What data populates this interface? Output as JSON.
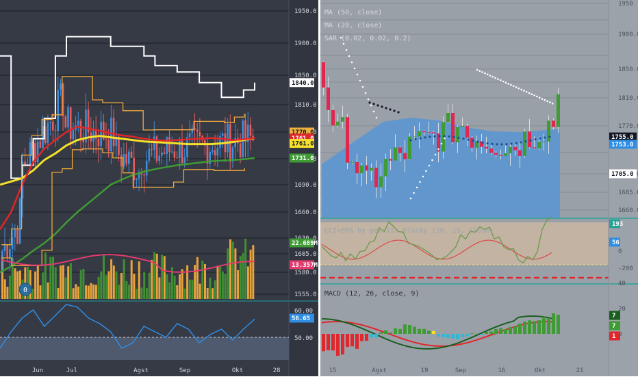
{
  "left": {
    "price_ticks": [
      "1950.0",
      "1900.0",
      "1850.0",
      "1810.0",
      "1770.0",
      "1730.0",
      "1690.0",
      "1660.0",
      "1630.0",
      "1605.0",
      "1580.0",
      "1555.0"
    ],
    "price_tick_values": [
      1950,
      1900,
      1850,
      1810,
      1770,
      1730,
      1690,
      1660,
      1630,
      1605,
      1580,
      1555
    ],
    "rsi_ticks": [
      "60.00",
      "50.00"
    ],
    "time_ticks": [
      "Jun",
      "Jul",
      "Agst",
      "Sep",
      "Okt",
      "28"
    ],
    "badges": [
      {
        "text": "1840.0",
        "bg": "#ffffff",
        "fg": "#131722",
        "value": 1840
      },
      {
        "text": "1770.0",
        "bg": "#f0b03c",
        "fg": "#131722",
        "value": 1770
      },
      {
        "text": "1761.0",
        "bg": "#e0272b",
        "fg": "#ffffff",
        "value": 1761
      },
      {
        "text": "1761.0",
        "bg": "#f5e12a",
        "fg": "#131722",
        "value": 1753
      },
      {
        "text": "1731.0",
        "bg": "#3f9b34",
        "fg": "#ffffff",
        "value": 1731
      },
      {
        "text": "22.689M",
        "bg": "#3f9b34",
        "fg": "#ffffff",
        "pane": "volume"
      },
      {
        "text": "13.357M",
        "bg": "#e23b6e",
        "fg": "#ffffff",
        "pane": "volume"
      },
      {
        "text": "56.65",
        "bg": "#2f8de4",
        "fg": "#ffffff",
        "pane": "rsi"
      }
    ],
    "events_icon": "0",
    "colors": {
      "up": "#3d8edb",
      "down": "#e55e5e",
      "highest": "#ffffff",
      "donchian": "#f0a93c",
      "ma_red": "#e0272b",
      "ma_yellow": "#f5e12a",
      "ma_green": "#3f9b34",
      "vol_up": "#3f8f34",
      "vol_down": "#e8a43b",
      "vol_ma": "#e23b6e",
      "rsi": "#2f8de4"
    }
  },
  "right": {
    "legends": [
      "MA (50, close)",
      "MA (20, close)",
      "SAR (0.02, 0.02, 0.2)",
      "CCI+EMA by perrito Blacky (20, 13, close)",
      "MACD (12, 26, close, 9)"
    ],
    "price_ticks": [
      "1950",
      "1900.0",
      "1850.0",
      "1810.0",
      "1770.0",
      "1705.0",
      "1685.0",
      "1660.0"
    ],
    "price_tick_values": [
      1950,
      1900,
      1850,
      1810,
      1770,
      1705,
      1685,
      1660
    ],
    "cci_ticks": [
      "0",
      "-200",
      "40"
    ],
    "macd_ticks": [
      "20",
      "0"
    ],
    "time_ticks": [
      "15",
      "Agst",
      "19",
      "Sep",
      "16",
      "Okt",
      "21"
    ],
    "badges": [
      {
        "text": "1755.0",
        "bg": "#131722",
        "fg": "#ffffff",
        "value": 1755
      },
      {
        "text": "1753.0",
        "bg": "#2f8de4",
        "fg": "#ffffff",
        "value": 1745
      },
      {
        "text": "1705.0",
        "bg": "#ffffff",
        "fg": "#131722",
        "value": 1705
      },
      {
        "text": "193",
        "bg": "#2aa198",
        "fg": "#ffffff",
        "pane": "cci"
      },
      {
        "text": "56",
        "bg": "#2f8de4",
        "fg": "#ffffff",
        "pane": "cci"
      },
      {
        "text": "7",
        "bg": "#1a5e20",
        "fg": "#ffffff",
        "pane": "macd"
      },
      {
        "text": "7",
        "bg": "#3f9b34",
        "fg": "#ffffff",
        "pane": "macd"
      },
      {
        "text": "1",
        "bg": "#e0272b",
        "fg": "#ffffff",
        "pane": "macd"
      }
    ],
    "colors": {
      "up": "#3f9b34",
      "down": "#e0274f",
      "area": "#5f97cf",
      "sar": "#ffffff",
      "cci": "#6a9a4a",
      "cci_ema": "#d9534f",
      "macd": "#1a5e20",
      "signal": "#e0272b",
      "hist_pos": "#3f9b34",
      "hist_neg": "#e0272b",
      "hist_neg2": "#2fb9d6",
      "hist_yellow": "#f5e12a"
    }
  },
  "chart_data": [
    {
      "type": "line",
      "title": "",
      "panel": "left",
      "xlabel": "",
      "ylabel": "",
      "x_tick_labels": [
        "Jun",
        "Jul",
        "Agst",
        "Sep",
        "Okt",
        "28"
      ],
      "ylim": [
        1540,
        1960
      ],
      "series": [
        {
          "values": [
            1880,
            1700,
            1720,
            1760,
            1790,
            1880,
            1910,
            1910,
            1910,
            1910,
            1895,
            1895,
            1895,
            1880,
            1865,
            1865,
            1855,
            1855,
            1840,
            1840,
            1820,
            1820,
            1830,
            1840
          ]
        },
        {
          "values": [
            1690,
            1695,
            1700,
            1712,
            1728,
            1738,
            1750,
            1758,
            1762,
            1764,
            1762,
            1760,
            1758,
            1756,
            1755,
            1754,
            1753,
            1752,
            1752,
            1752,
            1753,
            1755,
            1758,
            1761
          ]
        },
        {
          "values": [
            1640,
            1660,
            1690,
            1725,
            1745,
            1758,
            1770,
            1778,
            1775,
            1772,
            1768,
            1765,
            1763,
            1760,
            1758,
            1757,
            1758,
            1759,
            1760,
            1761,
            1760,
            1758,
            1759,
            1761
          ]
        },
        {
          "values": [
            1580,
            1588,
            1598,
            1610,
            1622,
            1635,
            1648,
            1660,
            1670,
            1680,
            1690,
            1698,
            1705,
            1710,
            1714,
            1717,
            1720,
            1722,
            1724,
            1726,
            1727,
            1728,
            1729,
            1731
          ]
        }
      ]
    },
    {
      "type": "line",
      "title": "",
      "panel": "left-rsi",
      "ylim": [
        30,
        70
      ],
      "series": [
        {
          "values": [
            46,
            52,
            57,
            60,
            54,
            58,
            62,
            61,
            57,
            55,
            52,
            46,
            48,
            54,
            52,
            50,
            55,
            53,
            48,
            51,
            53,
            49,
            53,
            56.65
          ]
        }
      ]
    },
    {
      "type": "bar",
      "title": "",
      "panel": "right-macd",
      "values": [
        -6,
        -8,
        -5,
        -3,
        -1,
        1,
        2,
        3,
        2,
        1,
        -1,
        -2,
        -1,
        0,
        1,
        2,
        3,
        4,
        5,
        6,
        7
      ]
    }
  ]
}
